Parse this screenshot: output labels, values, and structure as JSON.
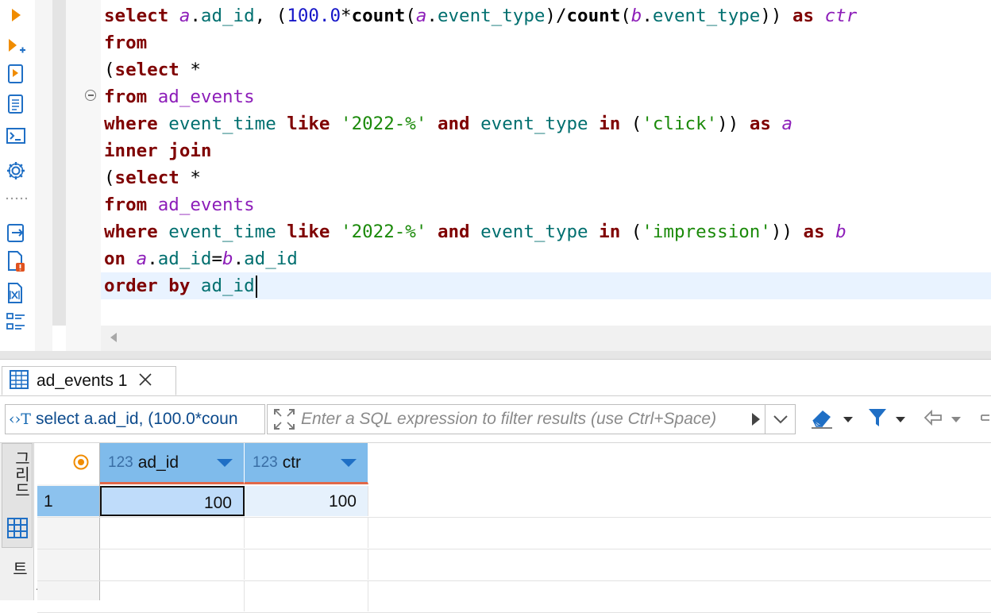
{
  "editor": {
    "lines": [
      [
        [
          "kw",
          "select "
        ],
        [
          "al",
          "a"
        ],
        [
          "pl",
          "."
        ],
        [
          "id",
          "ad_id"
        ],
        [
          "pl",
          ", ("
        ],
        [
          "num",
          "100.0"
        ],
        [
          "pl",
          "*"
        ],
        [
          "fn",
          "count"
        ],
        [
          "pl",
          "("
        ],
        [
          "al",
          "a"
        ],
        [
          "pl",
          "."
        ],
        [
          "id",
          "event_type"
        ],
        [
          "pl",
          ")/"
        ],
        [
          "fn",
          "count"
        ],
        [
          "pl",
          "("
        ],
        [
          "al",
          "b"
        ],
        [
          "pl",
          "."
        ],
        [
          "id",
          "event_type"
        ],
        [
          "pl",
          ")) "
        ],
        [
          "kw",
          "as "
        ],
        [
          "al",
          "ctr"
        ]
      ],
      [
        [
          "kw",
          "from"
        ]
      ],
      [
        [
          "pl",
          "("
        ],
        [
          "kw",
          "select "
        ],
        [
          "pl",
          "*"
        ]
      ],
      [
        [
          "kw",
          "from "
        ],
        [
          "tbl",
          "ad_events"
        ]
      ],
      [
        [
          "kw",
          "where "
        ],
        [
          "id",
          "event_time "
        ],
        [
          "kw",
          "like "
        ],
        [
          "str",
          "'2022-%'"
        ],
        [
          "pl",
          " "
        ],
        [
          "kw",
          "and "
        ],
        [
          "id",
          "event_type "
        ],
        [
          "kw",
          "in "
        ],
        [
          "pl",
          "("
        ],
        [
          "str",
          "'click'"
        ],
        [
          "pl",
          ")) "
        ],
        [
          "kw",
          "as "
        ],
        [
          "al",
          "a"
        ]
      ],
      [
        [
          "kw",
          "inner join"
        ]
      ],
      [
        [
          "pl",
          "("
        ],
        [
          "kw",
          "select "
        ],
        [
          "pl",
          "*"
        ]
      ],
      [
        [
          "kw",
          "from "
        ],
        [
          "tbl",
          "ad_events"
        ]
      ],
      [
        [
          "kw",
          "where "
        ],
        [
          "id",
          "event_time "
        ],
        [
          "kw",
          "like "
        ],
        [
          "str",
          "'2022-%'"
        ],
        [
          "pl",
          " "
        ],
        [
          "kw",
          "and "
        ],
        [
          "id",
          "event_type "
        ],
        [
          "kw",
          "in "
        ],
        [
          "pl",
          "("
        ],
        [
          "str",
          "'impression'"
        ],
        [
          "pl",
          ")) "
        ],
        [
          "kw",
          "as "
        ],
        [
          "al",
          "b"
        ]
      ],
      [
        [
          "kw",
          "on "
        ],
        [
          "al",
          "a"
        ],
        [
          "pl",
          "."
        ],
        [
          "id",
          "ad_id"
        ],
        [
          "pl",
          "="
        ],
        [
          "al",
          "b"
        ],
        [
          "pl",
          "."
        ],
        [
          "id",
          "ad_id"
        ]
      ],
      [
        [
          "kw",
          "order by "
        ],
        [
          "id",
          "ad_id"
        ]
      ]
    ]
  },
  "toolbar": {
    "icons": [
      "run-statement-icon",
      "run-in-new-tab-icon",
      "execute-script-icon",
      "execute-script-new-tab-icon",
      "console-icon",
      "settings-icon",
      "separator-dots",
      "export-icon",
      "explain-plan-icon",
      "variables-icon",
      "outline-icon"
    ]
  },
  "results": {
    "tab_label": "ad_events 1",
    "query_preview": "select a.ad_id, (100.0*coun",
    "query_icon": "‹›T",
    "filter_placeholder": "Enter a SQL expression to filter results (use Ctrl+Space)",
    "columns": [
      {
        "type": "123",
        "name": "ad_id"
      },
      {
        "type": "123",
        "name": "ctr"
      }
    ],
    "rows": [
      {
        "num": "1",
        "cells": [
          "100",
          "100"
        ]
      }
    ],
    "side_tabs": {
      "grid": "그리드",
      "text": "텍스트"
    }
  },
  "colors": {
    "keyword": "#7f0000",
    "alias": "#8d1eb9",
    "identifier": "#006f6f",
    "number": "#1515c8",
    "string": "#1b8a0a",
    "header_bg": "#7fbbeb",
    "selected_cell": "#bfdcfa",
    "current_line": "#e9f3ff"
  }
}
